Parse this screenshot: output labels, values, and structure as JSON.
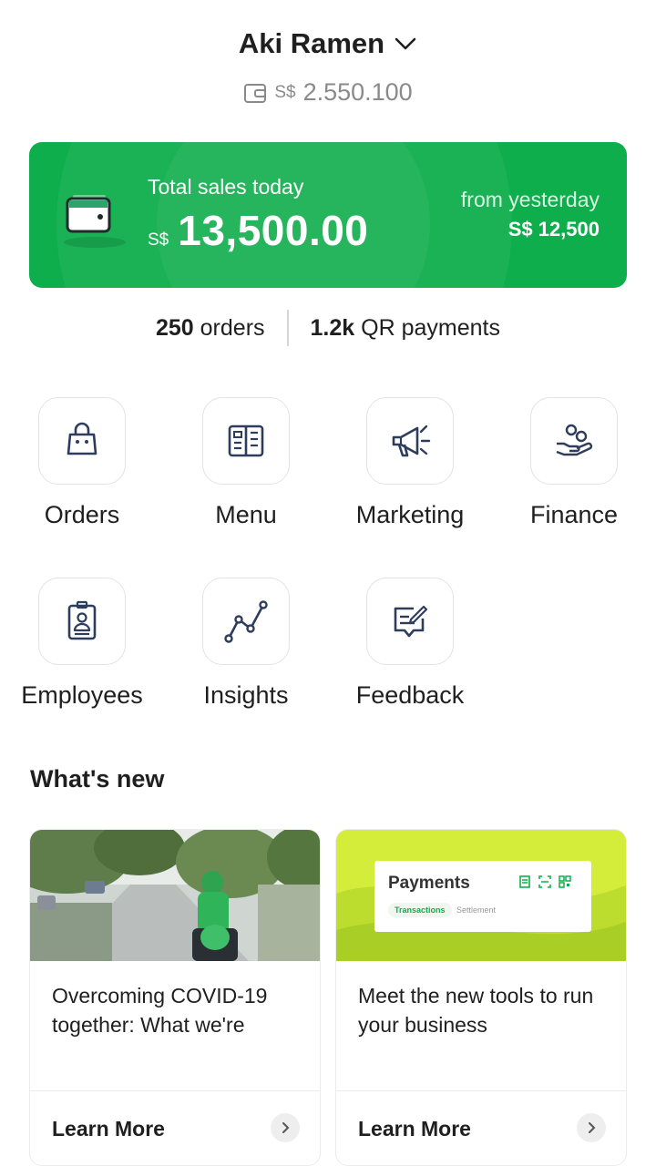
{
  "header": {
    "store_name": "Aki Ramen",
    "balance_currency": "S$",
    "balance_amount": "2.550.100"
  },
  "sales_card": {
    "label": "Total sales today",
    "currency": "S$",
    "amount": "13,500.00",
    "yesterday_label": "from yesterday",
    "yesterday_value": "S$ 12,500"
  },
  "stats": {
    "orders_count": "250",
    "orders_label": "orders",
    "qr_count": "1.2k",
    "qr_label": "QR payments"
  },
  "menu_tiles": [
    {
      "label": "Orders",
      "icon": "shopping-bag-icon"
    },
    {
      "label": "Menu",
      "icon": "menu-book-icon"
    },
    {
      "label": "Marketing",
      "icon": "megaphone-icon"
    },
    {
      "label": "Finance",
      "icon": "hand-coins-icon"
    },
    {
      "label": "Employees",
      "icon": "id-badge-icon"
    },
    {
      "label": "Insights",
      "icon": "line-chart-icon"
    },
    {
      "label": "Feedback",
      "icon": "feedback-icon"
    }
  ],
  "whats_new": {
    "title": "What's new",
    "cards": [
      {
        "text": "Overcoming COVID-19 together: What we're",
        "link": "Learn More"
      },
      {
        "text": "Meet the new tools to run your business",
        "link": "Learn More",
        "panel_title": "Payments",
        "tab_active": "Transactions",
        "tab_inactive": "Settlement"
      }
    ]
  },
  "colors": {
    "brand_green": "#0fae4c",
    "icon_navy": "#2f3d5c",
    "lime": "#cde83a"
  }
}
